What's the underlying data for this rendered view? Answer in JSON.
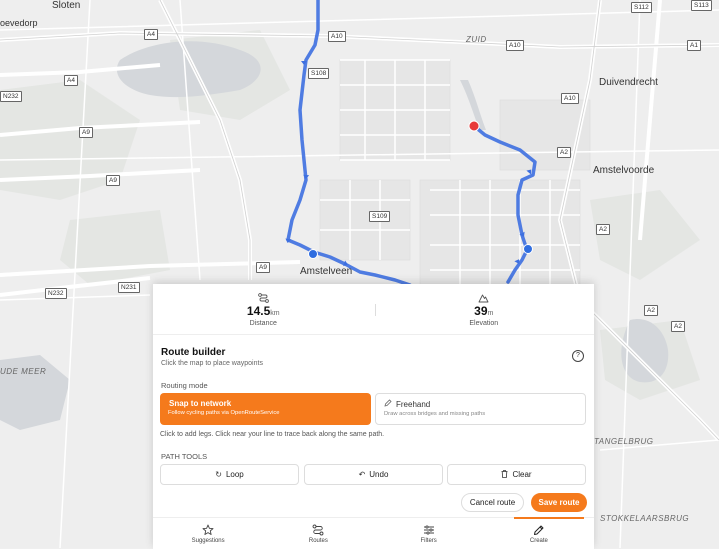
{
  "map": {
    "places": {
      "sloten": "Sloten",
      "oevedorp": "oevedorp",
      "amstelveen": "Amstelveen",
      "duivendrecht": "Duivendrecht",
      "amstelvoorde": "Amstelvoorde",
      "zuid": "ZUID",
      "ude_meer": "UDE MEER",
      "tangelbrug": "TANGELBRUG",
      "stokkelaarsbrug": "STOKKELAARSBRUG"
    },
    "shields": {
      "a4a": "A4",
      "a4b": "A4",
      "a10a": "A10",
      "a10b": "A10",
      "a10c": "A10",
      "s108": "S108",
      "s109": "S109",
      "a9a": "A9",
      "a9b": "A9",
      "a9c": "A9",
      "a2a": "A2",
      "a2b": "A2",
      "a2c": "A2",
      "a2d": "A2",
      "n232a": "N232",
      "n232b": "N232",
      "n231": "N231",
      "s112": "S112",
      "s113": "S113",
      "a1": "A1"
    },
    "colors": {
      "route": "#3d6fe0",
      "marker_start": "#e83a3a",
      "marker_mid": "#2f6de0"
    }
  },
  "stats": {
    "distance": {
      "icon": "route-icon",
      "value": "14.5",
      "unit": "km",
      "label": "Distance"
    },
    "elevation": {
      "icon": "mountain-icon",
      "value": "39",
      "unit": "m",
      "label": "Elevation"
    }
  },
  "builder": {
    "title": "Route builder",
    "subtitle": "Click the map to place waypoints",
    "help": "?",
    "routing_mode_label": "Routing mode",
    "modes": [
      {
        "title": "Snap to network",
        "desc": "Follow cycling paths via OpenRouteService"
      },
      {
        "title": "Freehand",
        "desc": "Draw across bridges and missing paths"
      }
    ],
    "hint": "Click to add legs. Click near your line to trace back along the same path.",
    "path_tools_label": "PATH TOOLS",
    "tools": {
      "loop": "Loop",
      "undo": "Undo",
      "clear": "Clear"
    },
    "cancel": "Cancel route",
    "save": "Save route"
  },
  "tabs": [
    {
      "label": "Suggestions",
      "icon": "star-icon"
    },
    {
      "label": "Routes",
      "icon": "routes-icon"
    },
    {
      "label": "Filters",
      "icon": "filters-icon"
    },
    {
      "label": "Create",
      "icon": "pencil-icon"
    }
  ],
  "accent": "#f57a1c"
}
